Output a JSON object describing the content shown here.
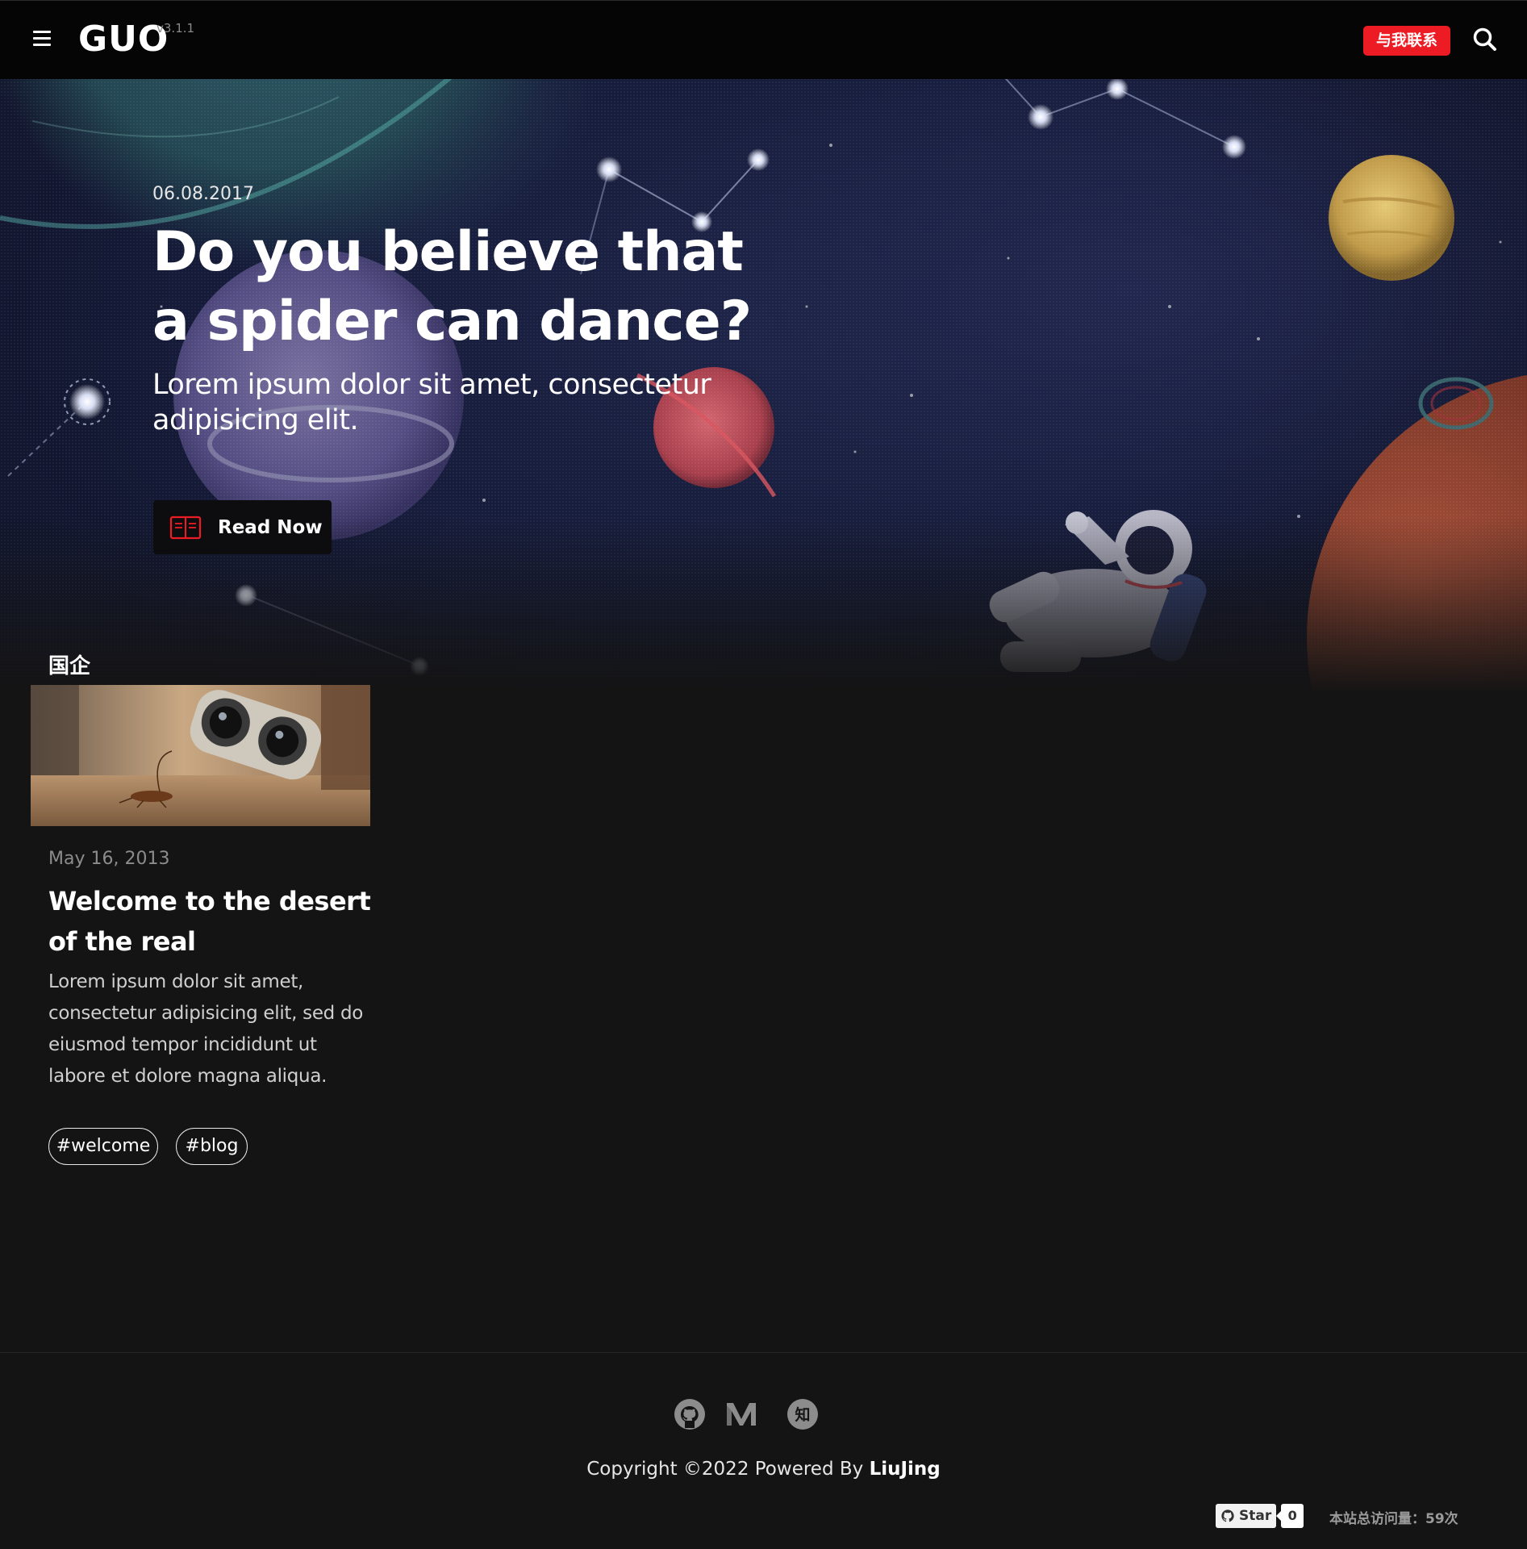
{
  "header": {
    "brand": "GUO",
    "version": "v3.1.1",
    "contact_label": "与我联系"
  },
  "hero": {
    "date": "06.08.2017",
    "title": "Do you believe that a spider can dance?",
    "subtitle": "Lorem ipsum dolor sit amet, consectetur adipisicing elit.",
    "cta_label": "Read Now"
  },
  "category": {
    "name": "国企"
  },
  "post": {
    "date": "May 16, 2013",
    "title": "Welcome to the desert of the real",
    "excerpt": "Lorem ipsum dolor sit amet, consectetur adipisicing elit, sed do eiusmod tempor incididunt ut labore et dolore magna aliqua.",
    "tags": [
      "#welcome",
      "#blog"
    ]
  },
  "footer": {
    "social_icons": [
      "github-icon",
      "medium-icon",
      "zhihu-icon"
    ],
    "zhihu_glyph": "知",
    "copyright_prefix": "Copyright ©2022 Powered By ",
    "author": "LiuJing",
    "star_label": "Star",
    "star_count": "0",
    "visits_label": "本站总访问量：59次"
  },
  "colors": {
    "accent": "#ed1c24",
    "background": "#141414",
    "nav": "#050505"
  }
}
